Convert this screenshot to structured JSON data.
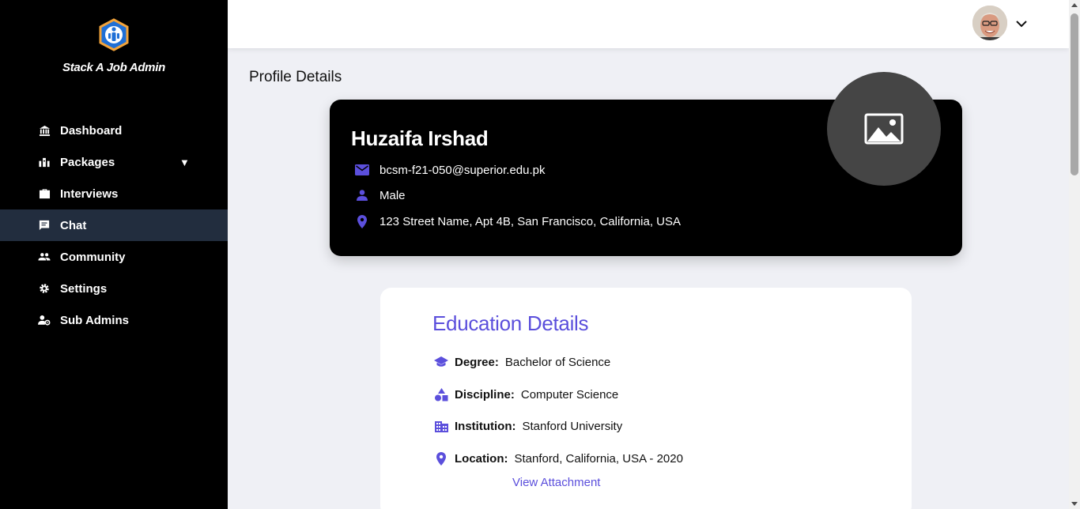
{
  "sidebar": {
    "brand": "Stack A Job Admin",
    "items": [
      {
        "label": "Dashboard",
        "icon": "bank-icon"
      },
      {
        "label": "Packages",
        "icon": "packages-icon"
      },
      {
        "label": "Interviews",
        "icon": "briefcase-icon"
      },
      {
        "label": "Chat",
        "icon": "chat-icon"
      },
      {
        "label": "Community",
        "icon": "people-icon"
      },
      {
        "label": "Settings",
        "icon": "gear-icon"
      },
      {
        "label": "Sub Admins",
        "icon": "user-gear-icon"
      }
    ],
    "packages_caret": "▼",
    "active_item": "Chat"
  },
  "page": {
    "title": "Profile Details"
  },
  "profile": {
    "name": "Huzaifa Irshad",
    "email": "bcsm-f21-050@superior.edu.pk",
    "gender": "Male",
    "address": "123 Street Name, Apt 4B, San Francisco, California, USA"
  },
  "education": {
    "title": "Education Details",
    "degree_label": "Degree:",
    "degree": "Bachelor of Science",
    "discipline_label": "Discipline:",
    "discipline": "Computer Science",
    "institution_label": "Institution:",
    "institution": "Stanford University",
    "location_label": "Location:",
    "location": "Stanford, California, USA - 2020",
    "view_attachment": "View Attachment"
  },
  "colors": {
    "accent": "#5b4fdc",
    "sidebar_bg": "#000000",
    "sidebar_active": "#222d3e",
    "page_bg": "#eff0f5"
  }
}
